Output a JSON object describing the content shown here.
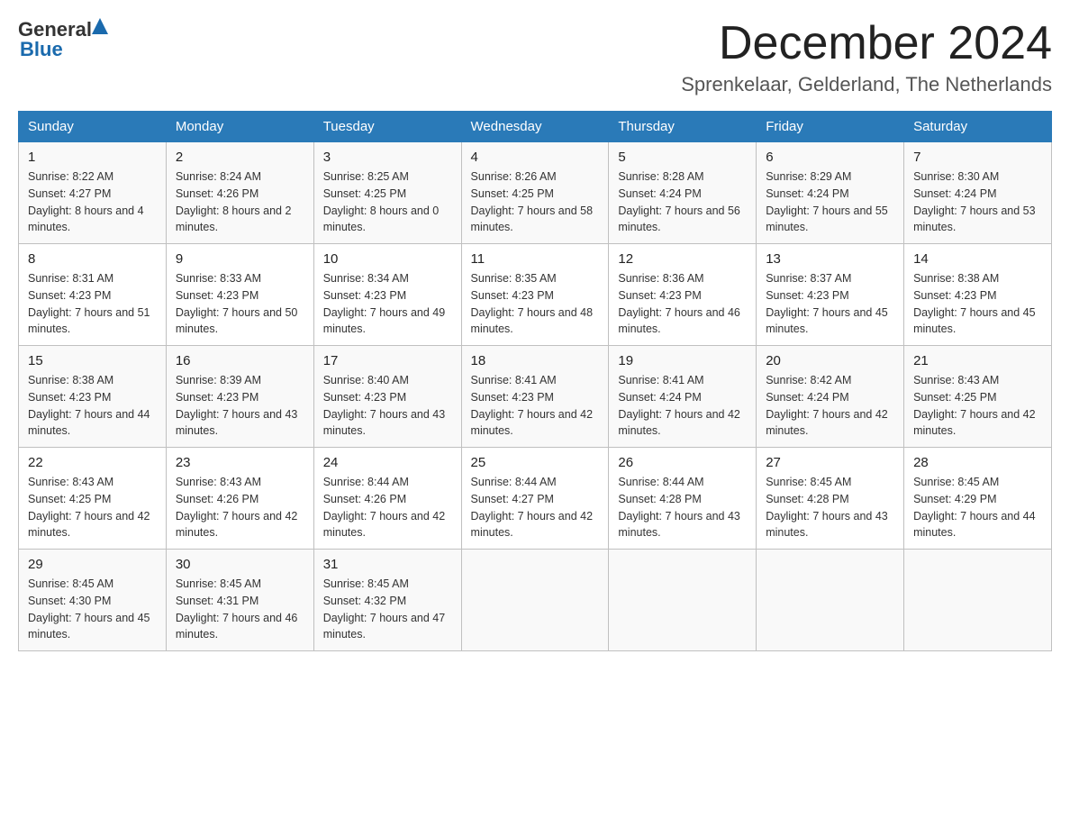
{
  "header": {
    "logo_line1": "General",
    "logo_line2": "Blue",
    "month_title": "December 2024",
    "location": "Sprenkelaar, Gelderland, The Netherlands"
  },
  "days_of_week": [
    "Sunday",
    "Monday",
    "Tuesday",
    "Wednesday",
    "Thursday",
    "Friday",
    "Saturday"
  ],
  "weeks": [
    [
      {
        "day": "1",
        "sunrise": "8:22 AM",
        "sunset": "4:27 PM",
        "daylight": "8 hours and 4 minutes."
      },
      {
        "day": "2",
        "sunrise": "8:24 AM",
        "sunset": "4:26 PM",
        "daylight": "8 hours and 2 minutes."
      },
      {
        "day": "3",
        "sunrise": "8:25 AM",
        "sunset": "4:25 PM",
        "daylight": "8 hours and 0 minutes."
      },
      {
        "day": "4",
        "sunrise": "8:26 AM",
        "sunset": "4:25 PM",
        "daylight": "7 hours and 58 minutes."
      },
      {
        "day": "5",
        "sunrise": "8:28 AM",
        "sunset": "4:24 PM",
        "daylight": "7 hours and 56 minutes."
      },
      {
        "day": "6",
        "sunrise": "8:29 AM",
        "sunset": "4:24 PM",
        "daylight": "7 hours and 55 minutes."
      },
      {
        "day": "7",
        "sunrise": "8:30 AM",
        "sunset": "4:24 PM",
        "daylight": "7 hours and 53 minutes."
      }
    ],
    [
      {
        "day": "8",
        "sunrise": "8:31 AM",
        "sunset": "4:23 PM",
        "daylight": "7 hours and 51 minutes."
      },
      {
        "day": "9",
        "sunrise": "8:33 AM",
        "sunset": "4:23 PM",
        "daylight": "7 hours and 50 minutes."
      },
      {
        "day": "10",
        "sunrise": "8:34 AM",
        "sunset": "4:23 PM",
        "daylight": "7 hours and 49 minutes."
      },
      {
        "day": "11",
        "sunrise": "8:35 AM",
        "sunset": "4:23 PM",
        "daylight": "7 hours and 48 minutes."
      },
      {
        "day": "12",
        "sunrise": "8:36 AM",
        "sunset": "4:23 PM",
        "daylight": "7 hours and 46 minutes."
      },
      {
        "day": "13",
        "sunrise": "8:37 AM",
        "sunset": "4:23 PM",
        "daylight": "7 hours and 45 minutes."
      },
      {
        "day": "14",
        "sunrise": "8:38 AM",
        "sunset": "4:23 PM",
        "daylight": "7 hours and 45 minutes."
      }
    ],
    [
      {
        "day": "15",
        "sunrise": "8:38 AM",
        "sunset": "4:23 PM",
        "daylight": "7 hours and 44 minutes."
      },
      {
        "day": "16",
        "sunrise": "8:39 AM",
        "sunset": "4:23 PM",
        "daylight": "7 hours and 43 minutes."
      },
      {
        "day": "17",
        "sunrise": "8:40 AM",
        "sunset": "4:23 PM",
        "daylight": "7 hours and 43 minutes."
      },
      {
        "day": "18",
        "sunrise": "8:41 AM",
        "sunset": "4:23 PM",
        "daylight": "7 hours and 42 minutes."
      },
      {
        "day": "19",
        "sunrise": "8:41 AM",
        "sunset": "4:24 PM",
        "daylight": "7 hours and 42 minutes."
      },
      {
        "day": "20",
        "sunrise": "8:42 AM",
        "sunset": "4:24 PM",
        "daylight": "7 hours and 42 minutes."
      },
      {
        "day": "21",
        "sunrise": "8:43 AM",
        "sunset": "4:25 PM",
        "daylight": "7 hours and 42 minutes."
      }
    ],
    [
      {
        "day": "22",
        "sunrise": "8:43 AM",
        "sunset": "4:25 PM",
        "daylight": "7 hours and 42 minutes."
      },
      {
        "day": "23",
        "sunrise": "8:43 AM",
        "sunset": "4:26 PM",
        "daylight": "7 hours and 42 minutes."
      },
      {
        "day": "24",
        "sunrise": "8:44 AM",
        "sunset": "4:26 PM",
        "daylight": "7 hours and 42 minutes."
      },
      {
        "day": "25",
        "sunrise": "8:44 AM",
        "sunset": "4:27 PM",
        "daylight": "7 hours and 42 minutes."
      },
      {
        "day": "26",
        "sunrise": "8:44 AM",
        "sunset": "4:28 PM",
        "daylight": "7 hours and 43 minutes."
      },
      {
        "day": "27",
        "sunrise": "8:45 AM",
        "sunset": "4:28 PM",
        "daylight": "7 hours and 43 minutes."
      },
      {
        "day": "28",
        "sunrise": "8:45 AM",
        "sunset": "4:29 PM",
        "daylight": "7 hours and 44 minutes."
      }
    ],
    [
      {
        "day": "29",
        "sunrise": "8:45 AM",
        "sunset": "4:30 PM",
        "daylight": "7 hours and 45 minutes."
      },
      {
        "day": "30",
        "sunrise": "8:45 AM",
        "sunset": "4:31 PM",
        "daylight": "7 hours and 46 minutes."
      },
      {
        "day": "31",
        "sunrise": "8:45 AM",
        "sunset": "4:32 PM",
        "daylight": "7 hours and 47 minutes."
      },
      null,
      null,
      null,
      null
    ]
  ]
}
